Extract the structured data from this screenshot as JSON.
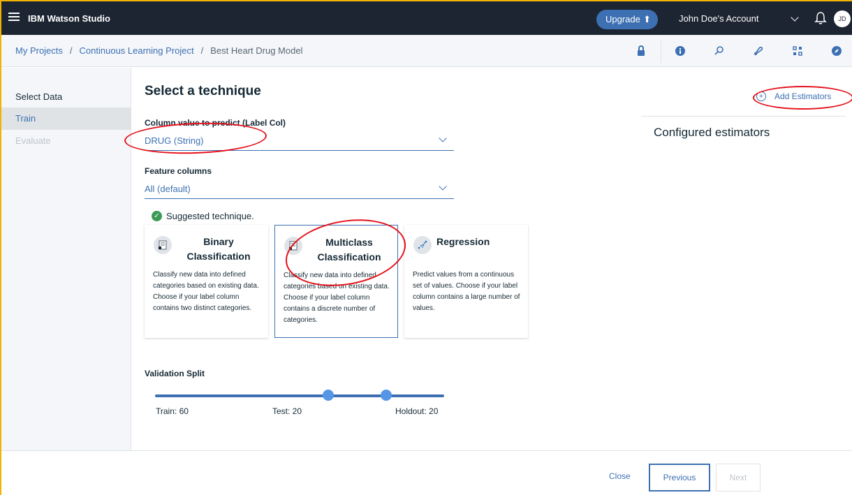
{
  "topnav": {
    "brand": "IBM Watson Studio",
    "upgrade_label": "Upgrade",
    "account_label": "John Doe's Account",
    "avatar_initials": "JD"
  },
  "breadcrumb": {
    "items": [
      "My Projects",
      "Continuous Learning Project"
    ],
    "current": "Best Heart Drug Model",
    "separator": "/"
  },
  "toolbar_icons": [
    "lock-icon",
    "info-icon",
    "find-icon",
    "deploy-icon",
    "grid-icon",
    "compass-icon"
  ],
  "sidebar": {
    "items": [
      {
        "label": "Select Data",
        "state": "normal"
      },
      {
        "label": "Train",
        "state": "active"
      },
      {
        "label": "Evaluate",
        "state": "disabled"
      }
    ]
  },
  "main": {
    "title": "Select a technique",
    "label_col": {
      "label": "Column value to predict (Label Col)",
      "value": "DRUG (String)"
    },
    "feature_cols": {
      "label": "Feature columns",
      "value": "All (default)"
    },
    "suggested": "Suggested technique.",
    "techniques": [
      {
        "title_line1": "Binary",
        "title_line2": "Classification",
        "description": "Classify new data into defined categories based on existing data. Choose if your label column contains two distinct categories.",
        "selected": false
      },
      {
        "title_line1": "Multiclass",
        "title_line2": "Classification",
        "description": "Classify new data into defined categories based on existing data. Choose if your label column contains a discrete number of categories.",
        "selected": true
      },
      {
        "title_line1": "Regression",
        "title_line2": "",
        "description": "Predict values from a continuous set of values. Choose if your label column contains a large number of values.",
        "selected": false
      }
    ],
    "validation": {
      "label": "Validation Split",
      "train_label": "Train: 60",
      "test_label": "Test: 20",
      "holdout_label": "Holdout: 20",
      "train": 60,
      "test": 20,
      "holdout": 20
    }
  },
  "right_panel": {
    "add_label": "Add Estimators",
    "configured_title": "Configured estimators"
  },
  "footer": {
    "close_label": "Close",
    "previous_label": "Previous",
    "next_label": "Next"
  },
  "colors": {
    "nav_bg": "#1d2532",
    "accent": "#3d70b2",
    "annotation": "#e5101a",
    "success": "#3d9a57"
  }
}
